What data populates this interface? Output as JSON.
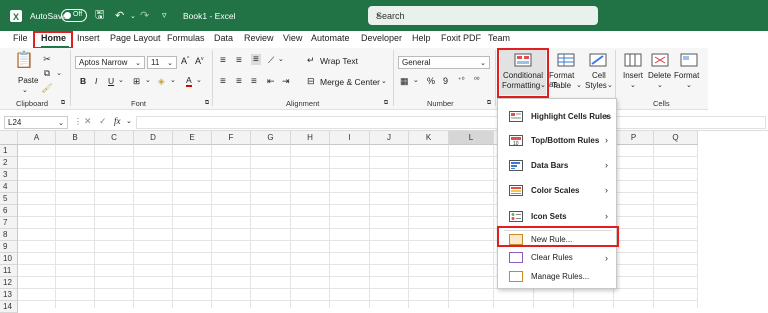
{
  "titlebar": {
    "autosave": "AutoSave",
    "toggle": "Off",
    "doc_title": "Book1  -  Excel",
    "search_placeholder": "Search"
  },
  "menu": [
    "File",
    "Home",
    "Insert",
    "Page Layout",
    "Formulas",
    "Data",
    "Review",
    "View",
    "Automate",
    "Developer",
    "Help",
    "Foxit PDF",
    "Team"
  ],
  "ribbon": {
    "paste": "Paste",
    "clipboard": "Clipboard",
    "font_name": "Aptos Narrow",
    "font_size": "11",
    "font_group": "Font",
    "wrap_text": "Wrap Text",
    "merge_center": "Merge & Center",
    "alignment": "Alignment",
    "number_format": "General",
    "number": "Number",
    "cond_fmt_line1": "Conditional",
    "cond_fmt_line2": "Formatting",
    "format_as_line1": "Format as",
    "format_as_line2": "Table",
    "cell_styles_line1": "Cell",
    "cell_styles_line2": "Styles",
    "insert": "Insert",
    "delete": "Delete",
    "format": "Format",
    "cells": "Cells"
  },
  "formula_bar": {
    "name_box": "L24",
    "fx": "fx"
  },
  "columns": [
    "A",
    "B",
    "C",
    "D",
    "E",
    "F",
    "G",
    "H",
    "I",
    "J",
    "K",
    "L",
    "M",
    "N",
    "O",
    "P",
    "Q"
  ],
  "rows": [
    "1",
    "2",
    "3",
    "4",
    "5",
    "6",
    "7",
    "8",
    "9",
    "10",
    "11",
    "12",
    "13",
    "14"
  ],
  "dropdown": {
    "items": [
      {
        "label": "Highlight Cells Rules",
        "has_submenu": true
      },
      {
        "label": "Top/Bottom Rules",
        "has_submenu": true
      },
      {
        "label": "Data Bars",
        "has_submenu": true
      },
      {
        "label": "Color Scales",
        "has_submenu": true
      },
      {
        "label": "Icon Sets",
        "has_submenu": true
      },
      {
        "label": "New Rule...",
        "has_submenu": false
      },
      {
        "label": "Clear Rules",
        "has_submenu": true
      },
      {
        "label": "Manage Rules...",
        "has_submenu": false
      }
    ]
  },
  "colors": {
    "excel_green": "#217346",
    "highlight_red": "#e02020"
  }
}
